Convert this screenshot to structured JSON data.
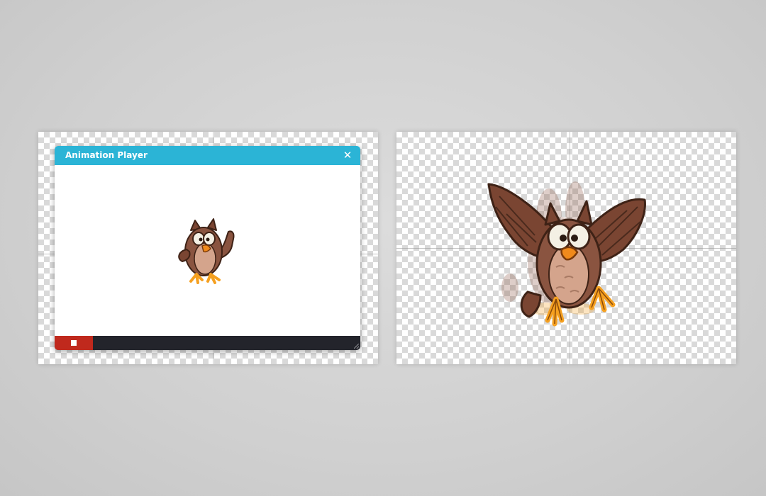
{
  "player": {
    "title": "Animation Player",
    "close_icon": "close-icon",
    "stop_icon": "stop-icon",
    "titlebar_color": "#2bb4d6",
    "stop_color": "#c0291d",
    "controls_color": "#23242b"
  },
  "colors": {
    "owl_brown": "#8a5440",
    "owl_dark": "#4a2a1d",
    "owl_belly": "#d4a48c",
    "owl_beak": "#f08a1c",
    "owl_feet": "#f5a020"
  }
}
